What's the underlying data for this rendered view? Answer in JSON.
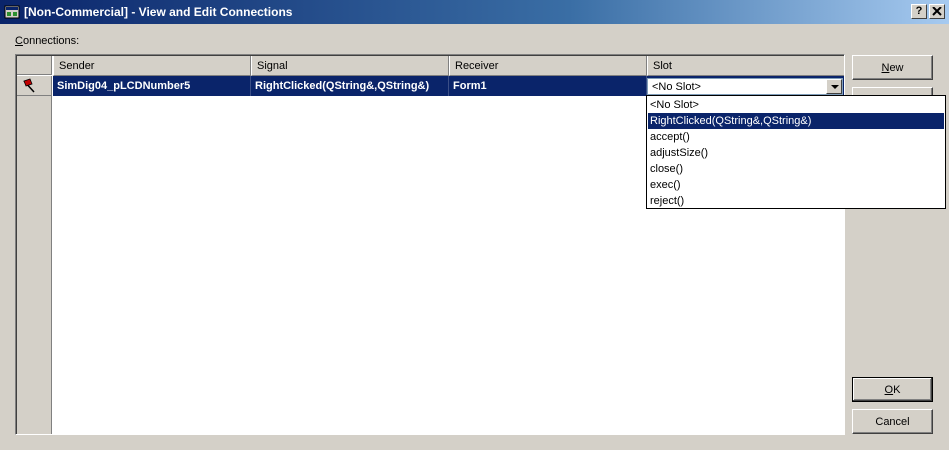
{
  "window": {
    "title": "[Non-Commercial] - View and Edit Connections",
    "help_btn": "?",
    "close_btn": "X"
  },
  "connections": {
    "label_accel": "C",
    "label_rest": "onnections:"
  },
  "table": {
    "columns": [
      "Sender",
      "Signal",
      "Receiver",
      "Slot"
    ],
    "rows": [
      {
        "sender": "SimDig04_pLCDNumber5",
        "signal": "RightClicked(QString&,QString&)",
        "receiver": "Form1",
        "slot": "<No Slot>"
      }
    ]
  },
  "slot_dropdown": {
    "selected_index": 1,
    "options": [
      "<No Slot>",
      "RightClicked(QString&,QString&)",
      "accept()",
      "adjustSize()",
      "close()",
      "exec()",
      "reject()"
    ]
  },
  "buttons": {
    "new_accel": "N",
    "new_rest": "ew",
    "ok_accel": "O",
    "ok_rest": "K",
    "cancel": "Cancel"
  },
  "icons": {
    "app": "app-window-icon",
    "row": "connection-flag-icon"
  }
}
